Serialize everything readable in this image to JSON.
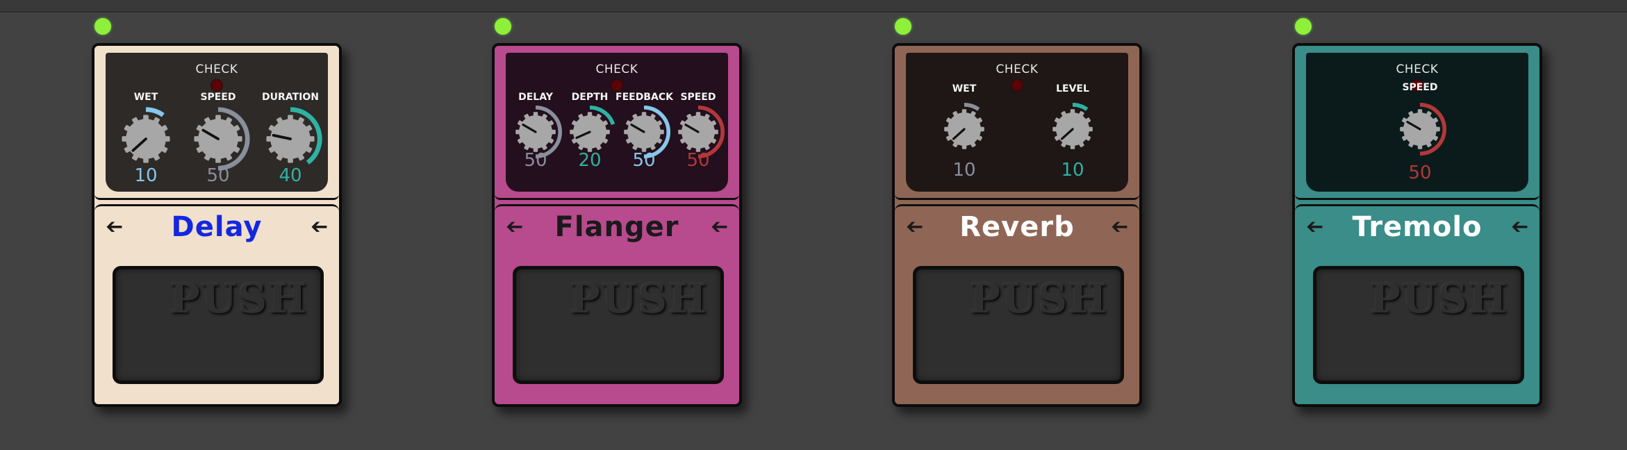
{
  "pedals": [
    {
      "name": "Delay",
      "check_label": "CHECK",
      "push_label": "PUSH",
      "name_color": "#1427e0",
      "body_color": "#f1e0cb",
      "panel_color": "#2d2a28",
      "knobs": [
        {
          "label": "WET",
          "value": "10",
          "arc_color": "#86c7ec",
          "level": 0.1
        },
        {
          "label": "SPEED",
          "value": "50",
          "arc_color": "#8a8f9c",
          "level": 0.5
        },
        {
          "label": "DURATION",
          "value": "40",
          "arc_color": "#2fb2a1",
          "level": 0.4
        }
      ]
    },
    {
      "name": "Flanger",
      "check_label": "CHECK",
      "push_label": "PUSH",
      "name_color": "#1a1a1a",
      "body_color": "#b84a8e",
      "panel_color": "#230f1d",
      "knobs": [
        {
          "label": "DELAY",
          "value": "50",
          "arc_color": "#8a8f9c",
          "level": 0.5
        },
        {
          "label": "DEPTH",
          "value": "20",
          "arc_color": "#2fb2a1",
          "level": 0.2
        },
        {
          "label": "FEEDBACK",
          "value": "50",
          "arc_color": "#86c7ec",
          "level": 0.5
        },
        {
          "label": "SPEED",
          "value": "50",
          "arc_color": "#b3383a",
          "level": 0.5
        }
      ]
    },
    {
      "name": "Reverb",
      "check_label": "CHECK",
      "push_label": "PUSH",
      "name_color": "#ffffff",
      "body_color": "#8f6655",
      "panel_color": "#1e1715",
      "knobs": [
        {
          "label": "WET",
          "value": "10",
          "arc_color": "#8a8f9c",
          "level": 0.1
        },
        {
          "label": "LEVEL",
          "value": "10",
          "arc_color": "#2fb2a1",
          "level": 0.1
        }
      ]
    },
    {
      "name": "Tremolo",
      "check_label": "CHECK",
      "push_label": "PUSH",
      "name_color": "#ffffff",
      "body_color": "#3a8d88",
      "panel_color": "#0b1b1c",
      "knobs": [
        {
          "label": "SPEED",
          "value": "50",
          "arc_color": "#b3383a",
          "level": 0.5
        }
      ]
    }
  ]
}
